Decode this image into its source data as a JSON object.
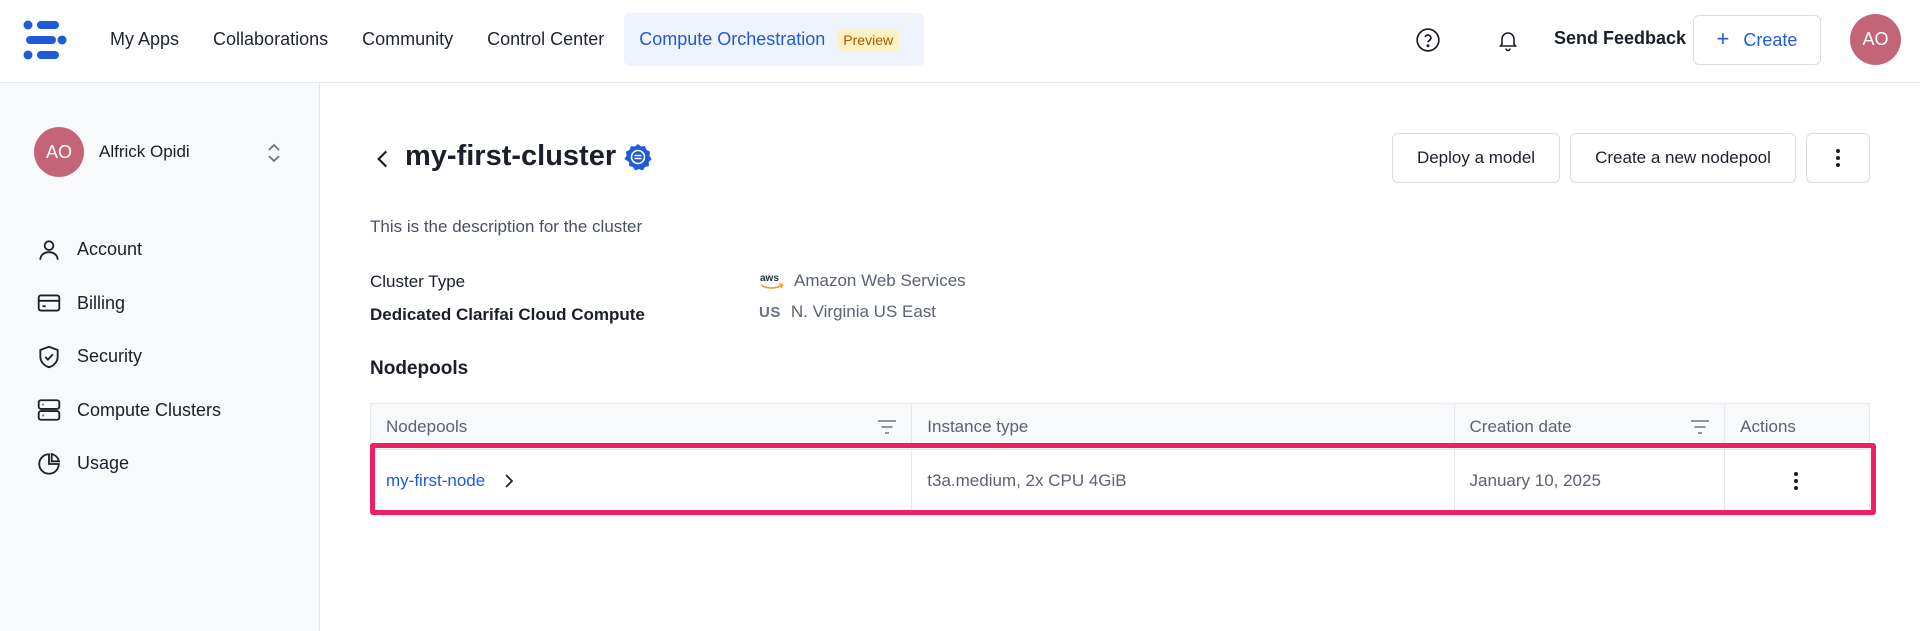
{
  "topbar": {
    "nav": [
      "My Apps",
      "Collaborations",
      "Community",
      "Control Center"
    ],
    "active_nav": "Compute Orchestration",
    "preview_badge": "Preview",
    "feedback": "Send Feedback",
    "create": "Create",
    "avatar_initials": "AO"
  },
  "sidebar": {
    "avatar_initials": "AO",
    "user_name": "Alfrick Opidi",
    "items": [
      {
        "label": "Account",
        "icon": "user-icon"
      },
      {
        "label": "Billing",
        "icon": "credit-card-icon"
      },
      {
        "label": "Security",
        "icon": "shield-icon"
      },
      {
        "label": "Compute Clusters",
        "icon": "server-icon"
      },
      {
        "label": "Usage",
        "icon": "pie-chart-icon"
      }
    ]
  },
  "cluster": {
    "title": "my-first-cluster",
    "description": "This is the description for the cluster",
    "type_label": "Cluster Type",
    "type_value": "Amazon Web Services",
    "compute_label": "Dedicated Clarifai Cloud Compute",
    "region_code": "US",
    "region_value": "N. Virginia US East"
  },
  "actions": {
    "deploy": "Deploy a model",
    "new_nodepool": "Create a new nodepool"
  },
  "nodepools": {
    "section_title": "Nodepools",
    "columns": [
      "Nodepools",
      "Instance type",
      "Creation date",
      "Actions"
    ],
    "rows": [
      {
        "name": "my-first-node",
        "instance_type": "t3a.medium, 2x CPU 4GiB",
        "created": "January 10, 2025"
      }
    ]
  },
  "colors": {
    "accent": "#1f5bd8",
    "highlight": "#ee1f62",
    "avatar": "#c46577"
  }
}
